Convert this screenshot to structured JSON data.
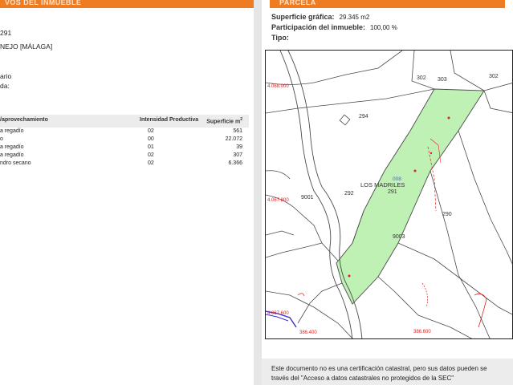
{
  "left_page": {
    "section_title": "VOS DEL INMUEBLE",
    "reference": "291",
    "location": "NEJO [MÁLAGA]",
    "field_1": "ario",
    "field_2": "da:",
    "table": {
      "headers": [
        "/aprovechamiento",
        "Intensidad Productiva",
        "Superficie m"
      ],
      "header_sup": "2",
      "rows": [
        {
          "use": "a regadío",
          "intensity": "02",
          "area": "561"
        },
        {
          "use": "o",
          "intensity": "00",
          "area": "22.072"
        },
        {
          "use": "a regadío",
          "intensity": "01",
          "area": "39"
        },
        {
          "use": "a regadío",
          "intensity": "02",
          "area": "307"
        },
        {
          "use": "ndro secano",
          "intensity": "02",
          "area": "6.366"
        }
      ]
    }
  },
  "right_page": {
    "section_title": "PARCELA",
    "surface_label": "Superficie gráfica:",
    "surface_value": "29.345 m2",
    "participation_label": "Participación del inmueble:",
    "participation_value": "100,00 %",
    "type_label": "Tipo:",
    "map": {
      "parcel_numbers": [
        "302",
        "303",
        "302",
        "294",
        "292",
        "291",
        "290",
        "9001",
        "9003"
      ],
      "place_name": "LOS MADRILES",
      "highlight_code": "008",
      "coord_labels": [
        "4.068.000",
        "4.067.800",
        "4.067.600",
        "386.400",
        "386.600"
      ]
    },
    "footer_line_1": "Este documento no es una certificación catastral, pero sus datos pueden se",
    "footer_line_2": "través del \"Acceso a datos catastrales no protegidos de la SEC\""
  },
  "colors": {
    "orange_bar": "#f07c22",
    "parcel_green": "#bff0b4",
    "coord_red": "#e02020",
    "road_blue": "#3a2fd0"
  }
}
